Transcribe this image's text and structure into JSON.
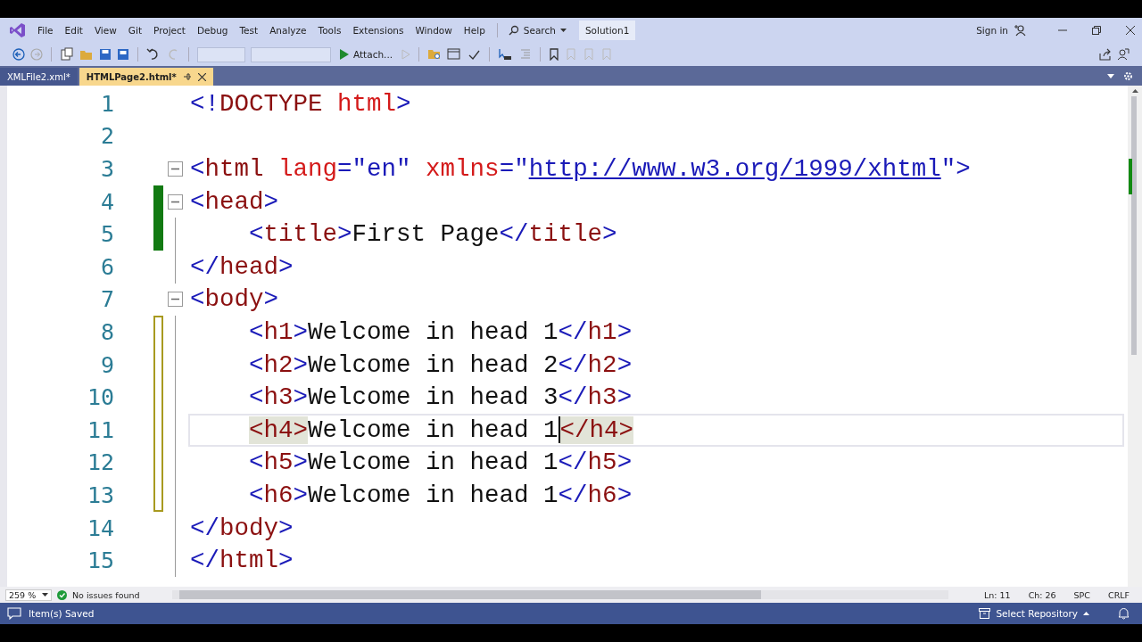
{
  "menu_bar": {
    "items": [
      "File",
      "Edit",
      "View",
      "Git",
      "Project",
      "Debug",
      "Test",
      "Analyze",
      "Tools",
      "Extensions",
      "Window",
      "Help"
    ],
    "search": "Search",
    "solution": "Solution1",
    "sign_in": "Sign in"
  },
  "toolbar": {
    "attach": "Attach..."
  },
  "tabs": [
    {
      "label": "XMLFile2.xml*",
      "selected": false
    },
    {
      "label": "HTMLPage2.html*",
      "selected": true
    }
  ],
  "editor": {
    "lines": [
      {
        "number": "1",
        "collapsible": false,
        "modified": false,
        "current": false,
        "tokens": [
          {
            "t": "<!",
            "kind": "punct"
          },
          {
            "t": "DOCTYPE",
            "kind": "tag"
          },
          {
            "t": " html",
            "kind": "attr"
          },
          {
            "t": ">",
            "kind": "punct"
          }
        ]
      },
      {
        "number": "2",
        "collapsible": false,
        "modified": false,
        "current": false
      },
      {
        "number": "3",
        "collapsible": true,
        "modified": false,
        "current": false,
        "tokens": [
          {
            "t": "<",
            "kind": "punct"
          },
          {
            "t": "html",
            "kind": "tag"
          },
          {
            "t": " lang",
            "kind": "attr"
          },
          {
            "t": "=\"",
            "kind": "punct"
          },
          {
            "t": "en",
            "kind": "value"
          },
          {
            "t": "\"",
            "kind": "punct"
          },
          {
            "t": " xmlns",
            "kind": "attr"
          },
          {
            "t": "=\"",
            "kind": "punct"
          },
          {
            "t": "http://www.w3.org/1999/xhtml",
            "kind": "url"
          },
          {
            "t": "\">",
            "kind": "punct"
          }
        ]
      },
      {
        "number": "4",
        "collapsible": true,
        "modified": true,
        "saved": true,
        "current": false,
        "tokens": [
          {
            "t": "<",
            "kind": "punct"
          },
          {
            "t": "head",
            "kind": "tag"
          },
          {
            "t": ">",
            "kind": "punct"
          }
        ]
      },
      {
        "number": "5",
        "collapsible": false,
        "modified": true,
        "saved": true,
        "current": false,
        "tokens": [
          {
            "t": "    <",
            "kind": "punct"
          },
          {
            "t": "title",
            "kind": "tag"
          },
          {
            "t": ">",
            "kind": "punct"
          },
          {
            "t": "First Page",
            "kind": "text"
          },
          {
            "t": "</",
            "kind": "punct"
          },
          {
            "t": "title",
            "kind": "tag"
          },
          {
            "t": ">",
            "kind": "punct"
          }
        ]
      },
      {
        "number": "6",
        "collapsible": false,
        "modified": false,
        "current": false,
        "tokens": [
          {
            "t": "</",
            "kind": "punct"
          },
          {
            "t": "head",
            "kind": "tag"
          },
          {
            "t": ">",
            "kind": "punct"
          }
        ]
      },
      {
        "number": "7",
        "collapsible": true,
        "modified": false,
        "current": false,
        "tokens": [
          {
            "t": "<",
            "kind": "punct"
          },
          {
            "t": "body",
            "kind": "tag"
          },
          {
            "t": ">",
            "kind": "punct"
          }
        ]
      },
      {
        "number": "8",
        "collapsible": false,
        "modified": true,
        "saved": false,
        "current": false,
        "tokens": [
          {
            "t": "    <",
            "kind": "punct"
          },
          {
            "t": "h1",
            "kind": "tag"
          },
          {
            "t": ">",
            "kind": "punct"
          },
          {
            "t": "Welcome in head 1",
            "kind": "text"
          },
          {
            "t": "</",
            "kind": "punct"
          },
          {
            "t": "h1",
            "kind": "tag"
          },
          {
            "t": ">",
            "kind": "punct"
          }
        ]
      },
      {
        "number": "9",
        "collapsible": false,
        "modified": true,
        "saved": false,
        "current": false,
        "tokens": [
          {
            "t": "    <",
            "kind": "punct"
          },
          {
            "t": "h2",
            "kind": "tag"
          },
          {
            "t": ">",
            "kind": "punct"
          },
          {
            "t": "Welcome in head 2",
            "kind": "text"
          },
          {
            "t": "</",
            "kind": "punct"
          },
          {
            "t": "h2",
            "kind": "tag"
          },
          {
            "t": ">",
            "kind": "punct"
          }
        ]
      },
      {
        "number": "10",
        "collapsible": false,
        "modified": true,
        "saved": false,
        "current": false,
        "tokens": [
          {
            "t": "    <",
            "kind": "punct"
          },
          {
            "t": "h3",
            "kind": "tag"
          },
          {
            "t": ">",
            "kind": "punct"
          },
          {
            "t": "Welcome in head 3",
            "kind": "text"
          },
          {
            "t": "</",
            "kind": "punct"
          },
          {
            "t": "h3",
            "kind": "tag"
          },
          {
            "t": ">",
            "kind": "punct"
          }
        ]
      },
      {
        "number": "11",
        "collapsible": false,
        "modified": true,
        "saved": false,
        "current": true,
        "tokens": [
          {
            "t": "    <h4>",
            "kind": "match"
          },
          {
            "t": "Welcome in head 1",
            "kind": "text"
          },
          {
            "kind": "caret"
          },
          {
            "t": "</h4>",
            "kind": "match"
          }
        ]
      },
      {
        "number": "12",
        "collapsible": false,
        "modified": true,
        "saved": false,
        "current": false,
        "tokens": [
          {
            "t": "    <",
            "kind": "punct"
          },
          {
            "t": "h5",
            "kind": "tag"
          },
          {
            "t": ">",
            "kind": "punct"
          },
          {
            "t": "Welcome in head 1",
            "kind": "text"
          },
          {
            "t": "</",
            "kind": "punct"
          },
          {
            "t": "h5",
            "kind": "tag"
          },
          {
            "t": ">",
            "kind": "punct"
          }
        ]
      },
      {
        "number": "13",
        "collapsible": false,
        "modified": true,
        "saved": false,
        "current": false,
        "tokens": [
          {
            "t": "    <",
            "kind": "punct"
          },
          {
            "t": "h6",
            "kind": "tag"
          },
          {
            "t": ">",
            "kind": "punct"
          },
          {
            "t": "Welcome in head 1",
            "kind": "text"
          },
          {
            "t": "</",
            "kind": "punct"
          },
          {
            "t": "h6",
            "kind": "tag"
          },
          {
            "t": ">",
            "kind": "punct"
          }
        ]
      },
      {
        "number": "14",
        "collapsible": false,
        "modified": false,
        "current": false,
        "tokens": [
          {
            "t": "</",
            "kind": "punct"
          },
          {
            "t": "body",
            "kind": "tag"
          },
          {
            "t": ">",
            "kind": "punct"
          }
        ]
      },
      {
        "number": "15",
        "collapsible": false,
        "modified": false,
        "current": false,
        "tokens": [
          {
            "t": "</",
            "kind": "punct"
          },
          {
            "t": "html",
            "kind": "tag"
          },
          {
            "t": ">",
            "kind": "punct"
          }
        ]
      }
    ]
  },
  "editor_status": {
    "zoom": "259 %",
    "issues": "No issues found",
    "line": "Ln: 11",
    "column": "Ch: 26",
    "indent": "SPC",
    "line_ending": "CRLF"
  },
  "status_bar": {
    "message": "Item(s) Saved",
    "repository": "Select Repository"
  }
}
